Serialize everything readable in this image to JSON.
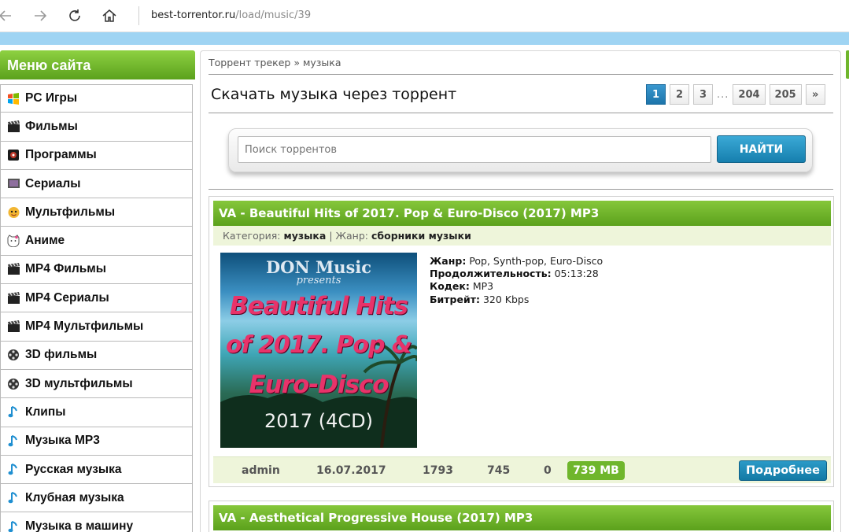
{
  "browser": {
    "url_host": "best-torrentor.ru",
    "url_path": "/load/music/39"
  },
  "sidebar": {
    "title": "Меню сайта",
    "items": [
      {
        "label": "PC Игры",
        "icon": "windows-flag-icon"
      },
      {
        "label": "Фильмы",
        "icon": "clapperboard-icon"
      },
      {
        "label": "Программы",
        "icon": "software-box-icon"
      },
      {
        "label": "Сериалы",
        "icon": "tv-screen-icon"
      },
      {
        "label": "Мультфильмы",
        "icon": "cartoon-face-icon"
      },
      {
        "label": "Аниме",
        "icon": "kitty-icon"
      },
      {
        "label": "MP4 Фильмы",
        "icon": "clapperboard-icon"
      },
      {
        "label": "MP4 Сериалы",
        "icon": "clapperboard-icon"
      },
      {
        "label": "MP4 Мультфильмы",
        "icon": "clapperboard-icon"
      },
      {
        "label": "3D фильмы",
        "icon": "film-reel-icon"
      },
      {
        "label": "3D мультфильмы",
        "icon": "film-reel-icon"
      },
      {
        "label": "Клипы",
        "icon": "music-note-icon"
      },
      {
        "label": "Музыка MP3",
        "icon": "music-note-icon"
      },
      {
        "label": "Русская музыка",
        "icon": "music-note-icon"
      },
      {
        "label": "Клубная музыка",
        "icon": "music-note-icon"
      },
      {
        "label": "Музыка в машину",
        "icon": "music-note-icon"
      }
    ]
  },
  "main": {
    "breadcrumb": "Торрент трекер » музыка",
    "title": "Скачать музыка через торрент",
    "pagination": {
      "pages": [
        "1",
        "2",
        "3"
      ],
      "dots": "...",
      "tail": [
        "204",
        "205"
      ],
      "next": "»",
      "current": "1"
    },
    "search": {
      "placeholder": "Поиск торрентов",
      "button": "НАЙТИ"
    }
  },
  "torrents": [
    {
      "title": "VA - Beautiful Hits of 2017. Pop & Euro-Disco (2017) MP3",
      "category_label": "Категория:",
      "category": "музыка",
      "separator": "|",
      "genre_label": "Жанр:",
      "genre": "сборники музыки",
      "poster": {
        "brand": "DON Music",
        "presents": "presents",
        "line1": "Beautiful Hits",
        "line2": "of 2017. Pop &",
        "line3": "Euro-Disco",
        "sub": "2017 (4CD)"
      },
      "info": [
        {
          "label": "Жанр:",
          "value": "Pop, Synth-pop, Euro-Disco"
        },
        {
          "label": "Продолжительность:",
          "value": "05:13:28"
        },
        {
          "label": "Кодек:",
          "value": "MP3"
        },
        {
          "label": "Битрейт:",
          "value": "320 Kbps"
        }
      ],
      "author": "admin",
      "date": "16.07.2017",
      "views": "1793",
      "downloads": "745",
      "comments": "0",
      "size": "739 MB",
      "more_button": "Подробнее"
    },
    {
      "title": "VA - Aesthetical Progressive House (2017) MP3"
    }
  ],
  "colors": {
    "accent_green": "#6fb62c",
    "accent_blue": "#1d74aa",
    "sky": "#9fd4f3"
  }
}
